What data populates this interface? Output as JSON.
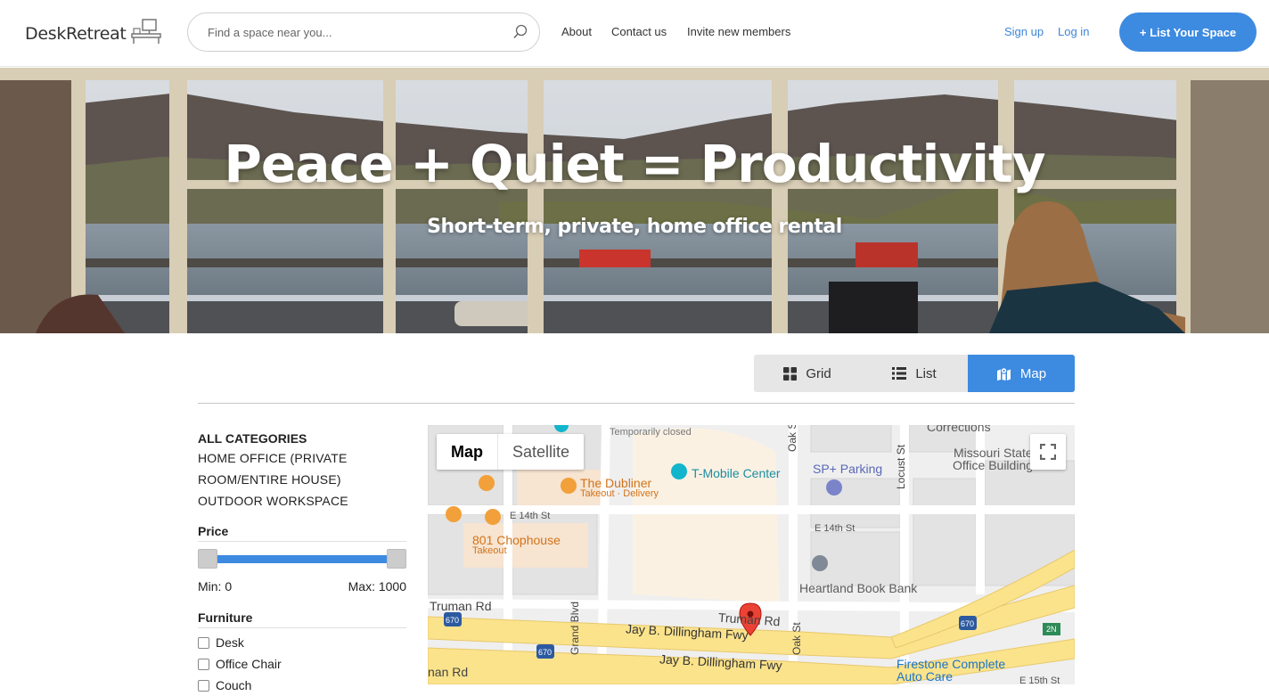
{
  "brand": {
    "name": "DeskRetreat"
  },
  "search": {
    "placeholder": "Find a space near you..."
  },
  "nav": {
    "about": "About",
    "contact": "Contact us",
    "invite": "Invite new members"
  },
  "auth": {
    "signup": "Sign up",
    "login": "Log in"
  },
  "cta": {
    "list_space": "+ List Your Space"
  },
  "hero": {
    "title": "Peace + Quiet = Productivity",
    "subtitle": "Short-term, private, home office rental"
  },
  "view_toggle": {
    "grid": "Grid",
    "list": "List",
    "map": "Map",
    "active": "map"
  },
  "categories": {
    "all": "ALL CATEGORIES",
    "items": [
      "HOME OFFICE (PRIVATE ROOM/ENTIRE HOUSE)",
      "OUTDOOR WORKSPACE"
    ]
  },
  "price": {
    "title": "Price",
    "min_label": "Min: 0",
    "max_label": "Max: 1000",
    "min": 0,
    "max": 1000
  },
  "furniture": {
    "title": "Furniture",
    "items": [
      "Desk",
      "Office Chair",
      "Couch"
    ]
  },
  "map": {
    "type_map": "Map",
    "type_satellite": "Satellite",
    "labels": {
      "temporarily_closed": "Temporarily closed",
      "corrections": "Corrections",
      "dubliner": "The Dubliner",
      "dubliner_sub": "Takeout · Delivery",
      "tmobile": "T-Mobile Center",
      "sp_parking": "SP+ Parking",
      "missouri": "Missouri State",
      "office_building": "Office Building",
      "e14_left": "E 14th St",
      "e14_right": "E 14th St",
      "chophouse": "801 Chophouse",
      "chophouse_sub": "Takeout",
      "heartland": "Heartland Book Bank",
      "truman_left": "Truman Rd",
      "truman_mid": "Truman Rd",
      "dillingham1": "Jay B. Dillingham Fwy",
      "dillingham2": "Jay B. Dillingham Fwy",
      "grand": "Grand Blvd",
      "oak1": "Oak St",
      "oak2": "Oak St",
      "locust": "Locust St",
      "firestone": "Firestone Complete",
      "autocare": "Auto Care",
      "e15": "E 15th St",
      "truman_bottom": "nan Rd",
      "shield1": "670",
      "shield2": "670",
      "shield3": "670",
      "exit": "2N"
    }
  },
  "colors": {
    "accent": "#3d8ae1",
    "link": "#3d86d8",
    "marker": "#ea4335",
    "highway": "#fbe38c"
  }
}
